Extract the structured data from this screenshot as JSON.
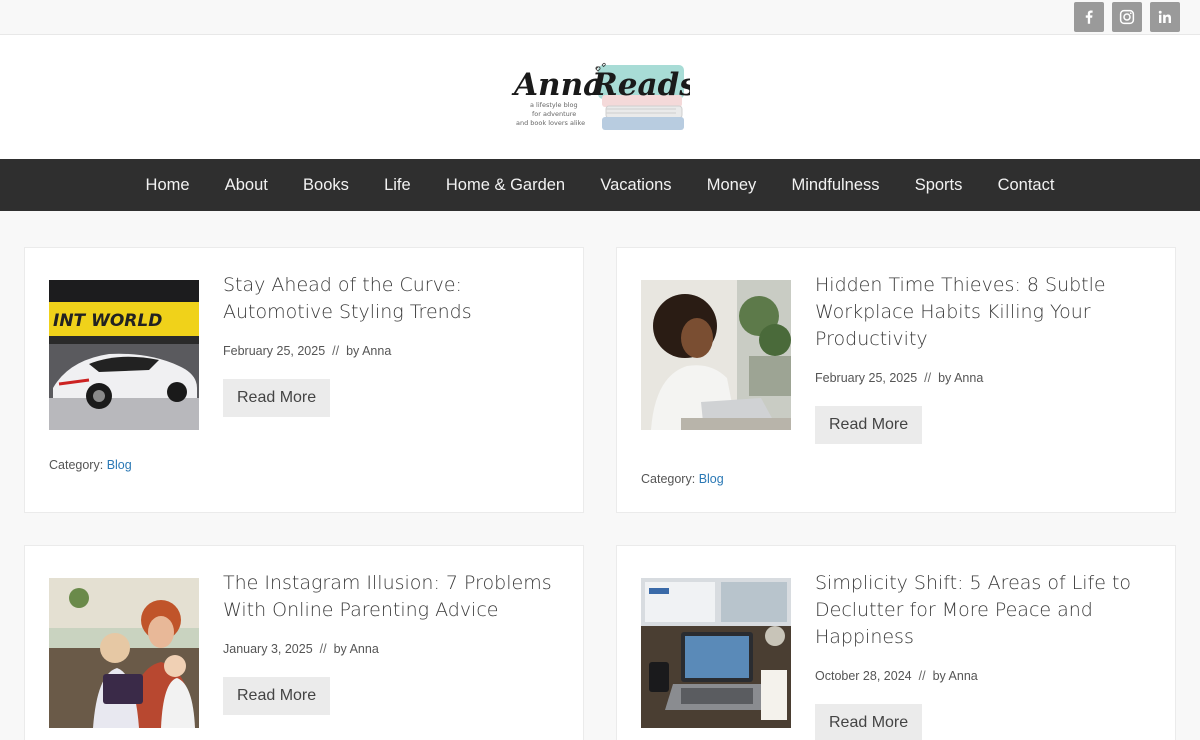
{
  "social": {
    "facebook_icon": "facebook-icon",
    "instagram_icon": "instagram-icon",
    "linkedin_icon": "linkedin-icon"
  },
  "logo": {
    "title": "Anna Reads",
    "tagline": "a lifestyle blog for adventure and book lovers alike"
  },
  "nav": {
    "items": [
      "Home",
      "About",
      "Books",
      "Life",
      "Home & Garden",
      "Vacations",
      "Money",
      "Mindfulness",
      "Sports",
      "Contact"
    ]
  },
  "posts": [
    {
      "title": "Stay Ahead of the Curve: Automotive Styling Trends",
      "date": "February 25, 2025",
      "separator": "//",
      "author": "by Anna",
      "button": "Read More",
      "category_label": "Category:",
      "category": "Blog"
    },
    {
      "title": "Hidden Time Thieves: 8 Subtle Workplace Habits Killing Your Productivity",
      "date": "February 25, 2025",
      "separator": "//",
      "author": "by Anna",
      "button": "Read More",
      "category_label": "Category:",
      "category": "Blog"
    },
    {
      "title": "The Instagram Illusion: 7 Problems With Online Parenting Advice",
      "date": "January 3, 2025",
      "separator": "//",
      "author": "by Anna",
      "button": "Read More"
    },
    {
      "title": "Simplicity Shift: 5 Areas of Life to Declutter for More Peace and Happiness",
      "date": "October 28, 2024",
      "separator": "//",
      "author": "by Anna",
      "button": "Read More"
    }
  ],
  "colors": {
    "nav_bg": "#2f2f2f",
    "link": "#2a78b5",
    "button_bg": "#ebebeb",
    "social_bg": "#9a9a9a"
  }
}
